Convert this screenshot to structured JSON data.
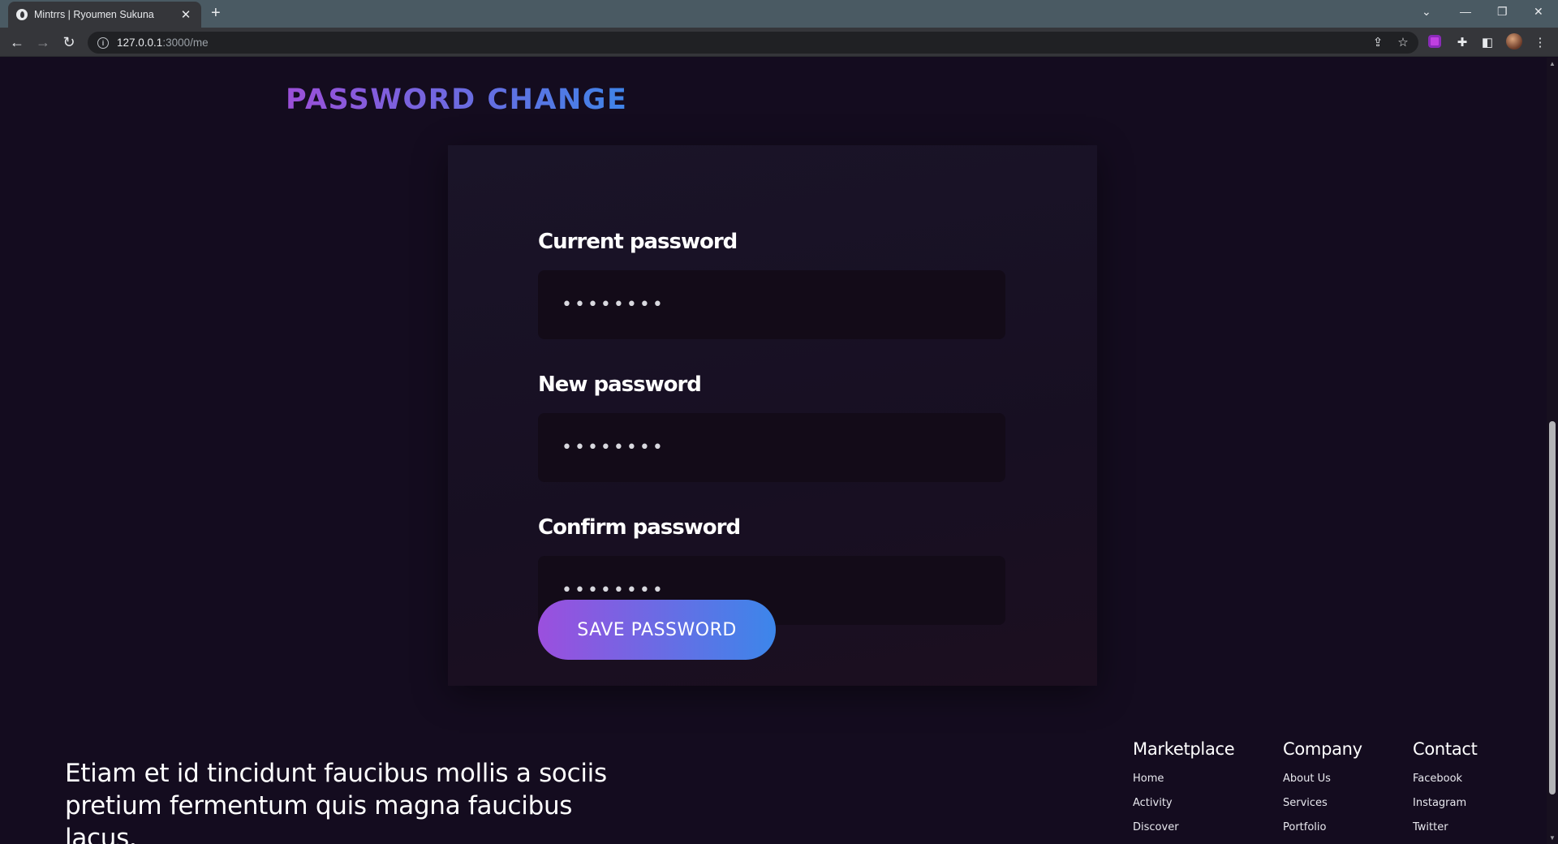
{
  "browser": {
    "tab_title": "Mintrrs | Ryoumen Sukuna",
    "url_host": "127.0.0.1",
    "url_path": ":3000/me"
  },
  "page": {
    "heading": "PASSWORD CHANGE",
    "form": {
      "current_label": "Current password",
      "current_value": "••••••••",
      "new_label": "New password",
      "new_value": "••••••••",
      "confirm_label": "Confirm password",
      "confirm_value": "••••••••",
      "save_label": "SAVE PASSWORD"
    },
    "footer": {
      "tagline": "Etiam et id tincidunt faucibus mollis a sociis pretium fermentum quis magna faucibus lacus.",
      "columns": [
        {
          "title": "Marketplace",
          "links": [
            "Home",
            "Activity",
            "Discover"
          ]
        },
        {
          "title": "Company",
          "links": [
            "About Us",
            "Services",
            "Portfolio"
          ]
        },
        {
          "title": "Contact",
          "links": [
            "Facebook",
            "Instagram",
            "Twitter"
          ]
        }
      ]
    }
  },
  "colors": {
    "background": "#140c1f",
    "gradient_start": "#9b4fde",
    "gradient_end": "#3c86ea",
    "input_bg": "#130b18"
  },
  "icons": {
    "back": "arrow-left-icon",
    "forward": "arrow-right-icon",
    "reload": "reload-icon",
    "info": "info-icon",
    "share": "share-icon",
    "star": "star-icon",
    "extensions": "puzzle-icon",
    "sidepanel": "sidepanel-icon",
    "menu": "kebab-menu-icon"
  }
}
